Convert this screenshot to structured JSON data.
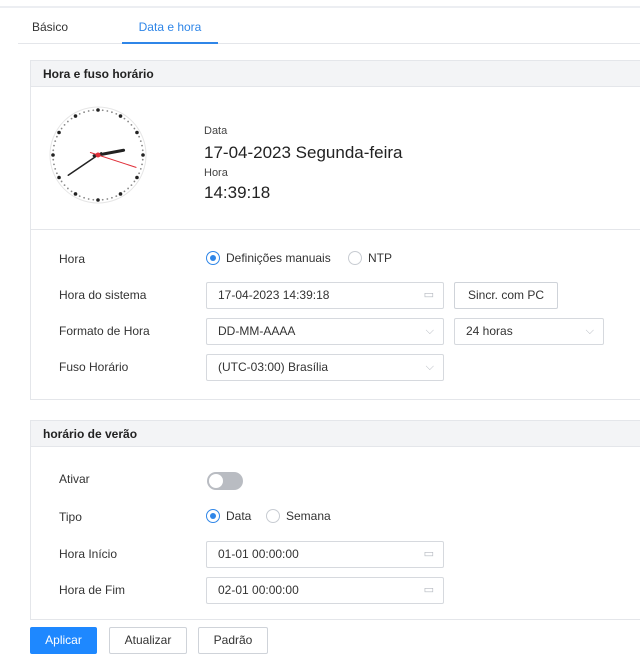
{
  "tabs": [
    {
      "label": "Básico",
      "active": false
    },
    {
      "label": "Data e hora",
      "active": true
    }
  ],
  "time_section": {
    "title": "Hora e fuso horário",
    "date_label": "Data",
    "date_value": "17-04-2023 Segunda-feira",
    "time_label": "Hora",
    "time_value": "14:39:18",
    "clock": {
      "hour": 14,
      "minute": 39,
      "second": 18
    }
  },
  "form": {
    "hora": {
      "label": "Hora",
      "options": [
        "Definições manuais",
        "NTP"
      ],
      "selected": "Definições manuais"
    },
    "system_time": {
      "label": "Hora do sistema",
      "value": "17-04-2023 14:39:18",
      "sync_button": "Sincr. com PC"
    },
    "format": {
      "label": "Formato de Hora",
      "date_format": "DD-MM-AAAA",
      "hour_format": "24 horas"
    },
    "timezone": {
      "label": "Fuso Horário",
      "value": "(UTC-03:00) Brasília"
    }
  },
  "dst_section": {
    "title": "horário de verão",
    "enable_label": "Ativar",
    "enabled": false,
    "type_label": "Tipo",
    "type_options": [
      "Data",
      "Semana"
    ],
    "type_selected": "Data",
    "start_label": "Hora Início",
    "start_value": "01-01 00:00:00",
    "end_label": "Hora de Fim",
    "end_value": "02-01 00:00:00"
  },
  "actions": {
    "apply": "Aplicar",
    "refresh": "Atualizar",
    "default": "Padrão"
  },
  "colors": {
    "accent": "#2f86e8",
    "primary_button": "#1e88ff",
    "toggle_off": "#b9bcc2",
    "second_hand": "#e0303a"
  },
  "icons": {
    "calendar": "calendar-icon",
    "dropdown": "chevron-down-icon"
  }
}
